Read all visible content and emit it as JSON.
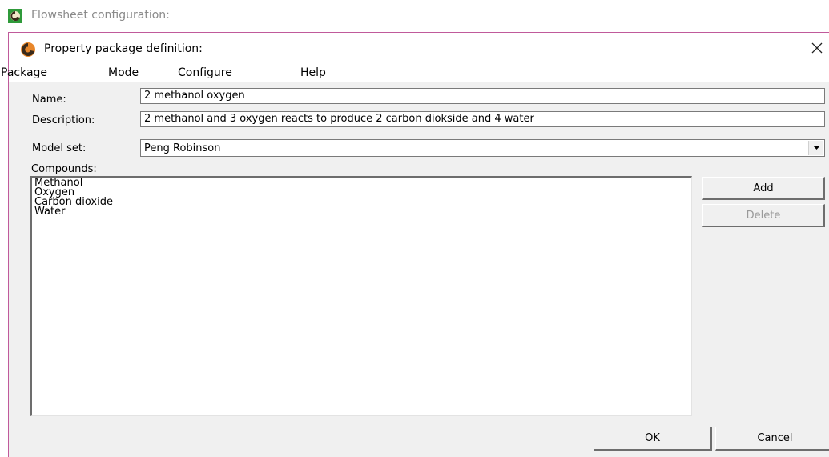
{
  "outer_window": {
    "title": "Flowsheet configuration:"
  },
  "dialog": {
    "title": "Property package definition:",
    "menu": [
      "Package",
      "Mode",
      "Configure",
      "Help"
    ],
    "name_label": "Name:",
    "name_value": "2 methanol oxygen",
    "description_label": "Description:",
    "description_value": "2 methanol  and 3 oxygen reacts to produce 2 carbon diokside and 4 water",
    "model_set_label": "Model set:",
    "model_set_value": "Peng Robinson",
    "compounds_label": "Compounds:",
    "compounds": [
      "Methanol",
      "Oxygen",
      "Carbon dioxide",
      "Water"
    ],
    "add_label": "Add",
    "delete_label": "Delete",
    "ok_label": "OK",
    "cancel_label": "Cancel"
  },
  "colors": {
    "dialog_border": "#c05a9b",
    "logo_orange": "#e8862a",
    "logo_dark": "#3a2a1a",
    "outer_logo_green": "#2f9a3a"
  },
  "icons": {
    "outer_logo": "cofe-logo-icon",
    "dialog_logo": "cofe-logo-icon",
    "close": "close-icon",
    "dropdown": "chevron-down-icon"
  }
}
